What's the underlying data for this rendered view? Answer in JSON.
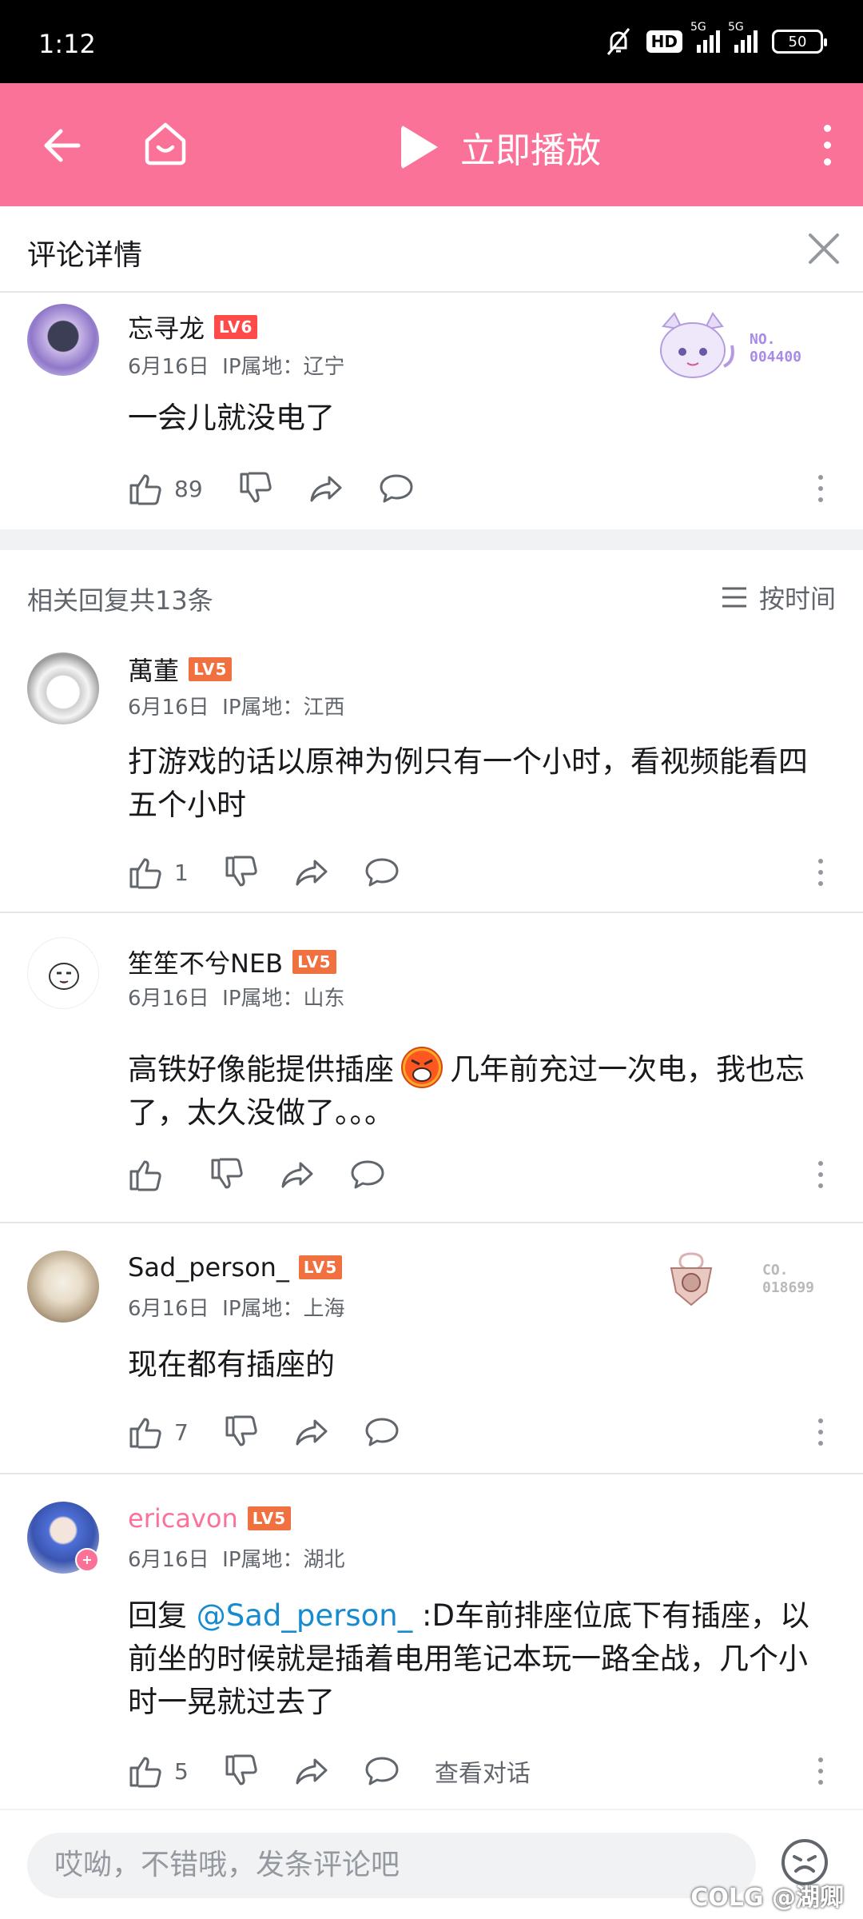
{
  "status_bar": {
    "time": "1:12",
    "hd_label": "HD",
    "network1": "5G",
    "network2": "5G",
    "battery": "50"
  },
  "app_bar": {
    "play_label": "立即播放",
    "color": "#fb7299"
  },
  "detail": {
    "title": "评论详情"
  },
  "root_comment": {
    "username": "忘寻龙",
    "level": "LV6",
    "date": "6月16日",
    "ip": "IP属地：辽宁",
    "text": "一会儿就没电了",
    "likes": "89",
    "badge_prefix": "NO.",
    "badge_number": "004400"
  },
  "replies_header": {
    "count_label": "相关回复共13条",
    "sort_label": "按时间"
  },
  "replies": [
    {
      "username": "萬董",
      "level": "LV5",
      "date": "6月16日",
      "ip": "IP属地：江西",
      "text": "打游戏的话以原神为例只有一个小时，看视频能看四五个小时",
      "likes": "1"
    },
    {
      "username": "笙笙不兮NEB",
      "level": "LV5",
      "date": "6月16日",
      "ip": "IP属地：山东",
      "text_a": "高铁好像能提供插座",
      "text_b": "几年前充过一次电，我也忘了，太久没做了。。。",
      "likes": ""
    },
    {
      "username": "Sad_person_",
      "level": "LV5",
      "date": "6月16日",
      "ip": "IP属地：上海",
      "text": "现在都有插座的",
      "likes": "7",
      "badge_prefix": "CO.",
      "badge_number": "018699"
    },
    {
      "username": "ericavon",
      "level": "LV5",
      "date": "6月16日",
      "ip": "IP属地：湖北",
      "reply_prefix": "回复 ",
      "mention": "@Sad_person_",
      "text": " :D车前排座位底下有插座，以前坐的时候就是插着电用笔记本玩一路全战，几个小时一晃就过去了",
      "likes": "5",
      "view_conversation": "查看对话",
      "name_color": "#fb7299"
    }
  ],
  "bottom_bar": {
    "placeholder": "哎呦，不错哦，发条评论吧",
    "watermark": "COLG @湖卿"
  }
}
